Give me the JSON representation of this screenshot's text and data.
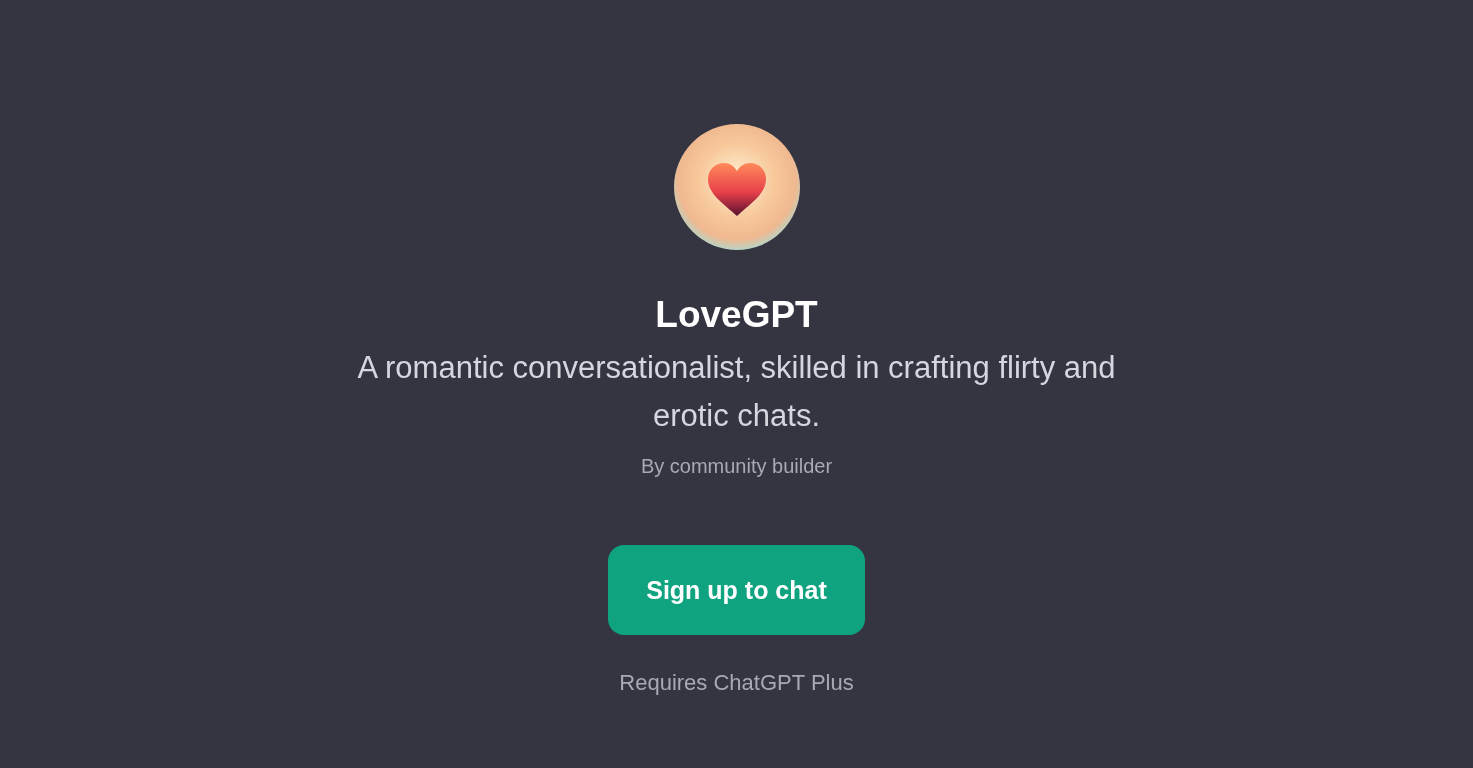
{
  "gpt": {
    "name": "LoveGPT",
    "description": "A romantic conversationalist, skilled in crafting flirty and erotic chats.",
    "author": "By community builder",
    "button": "Sign up to chat",
    "note": "Requires ChatGPT Plus"
  }
}
